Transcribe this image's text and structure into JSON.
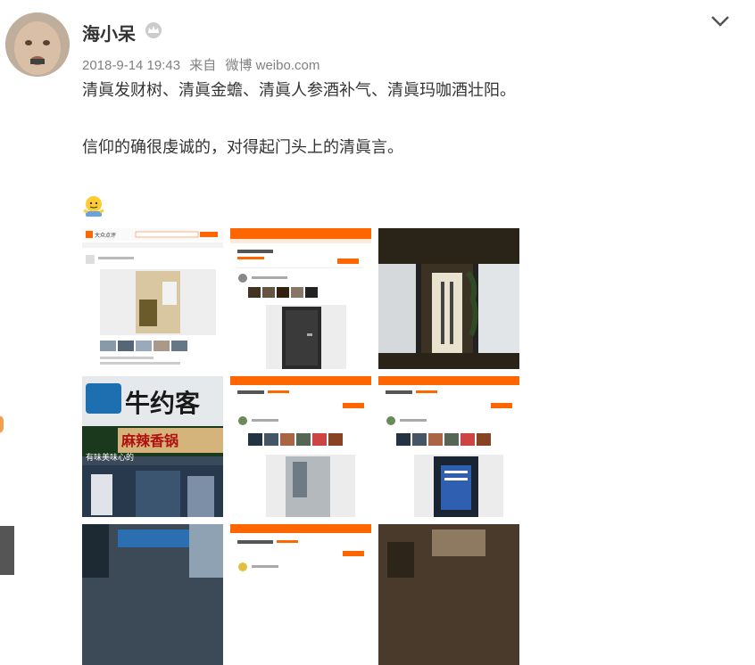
{
  "post": {
    "username": "海小呆",
    "timestamp": "2018-9-14 19:43",
    "source_prefix": "来自",
    "source_app": "微博 weibo.com",
    "line1": "清眞发财树、清眞金蟾、清眞人参酒补气、清眞玛咖酒壮阳。",
    "line2": "信仰的确很虔诚的，对得起门头上的清眞言。"
  },
  "images": {
    "shop_sign_top": "牛约客",
    "shop_sign_bottom": "麻辣香锅",
    "shop_sign_small": "有味美味心的",
    "dianping_logo": "大众点评"
  },
  "icons": {
    "crown": "crown-icon",
    "expand": "chevron-down-icon",
    "emoji": "shrug-emoji-icon"
  },
  "colors": {
    "accent": "#ff6600",
    "meta_gray": "#808080",
    "text": "#333333"
  }
}
